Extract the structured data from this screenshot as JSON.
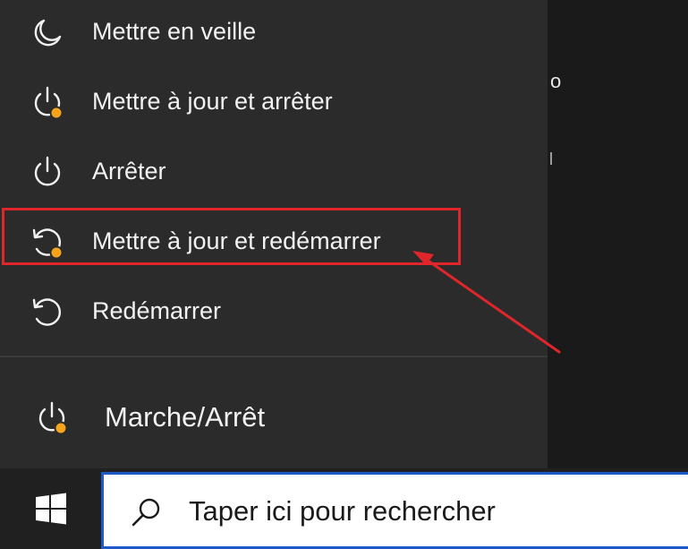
{
  "power_menu": {
    "items": [
      {
        "label": "Mettre en veille",
        "icon": "moon-icon"
      },
      {
        "label": "Mettre à jour et arrêter",
        "icon": "power-update-icon"
      },
      {
        "label": "Arrêter",
        "icon": "power-icon"
      },
      {
        "label": "Mettre à jour et redémarrer",
        "icon": "restart-update-icon"
      },
      {
        "label": "Redémarrer",
        "icon": "restart-icon"
      }
    ],
    "highlighted_item": "Mettre à jour et redémarrer",
    "highlight_color": "#e0262b",
    "update_badge_color": "#f7a41d"
  },
  "power_button": {
    "label": "Marche/Arrêt",
    "icon": "power-update-icon"
  },
  "right_pane": {
    "fragment_text": "o"
  },
  "taskbar": {
    "start_icon": "windows-logo-icon",
    "search": {
      "placeholder": "Taper ici pour rechercher",
      "icon": "search-icon",
      "border_color": "#1c5ac8"
    }
  }
}
